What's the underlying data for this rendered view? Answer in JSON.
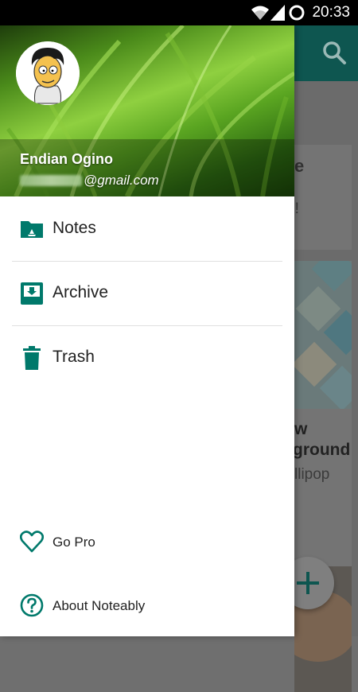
{
  "status_bar": {
    "time": "20:33",
    "icons": [
      "wifi-icon",
      "signal-icon",
      "sync-icon"
    ]
  },
  "drawer": {
    "user": {
      "name": "Endian Ogino",
      "email_visible": "@gmail.com"
    },
    "menu": [
      {
        "label": "Notes",
        "icon": "drive-folder-icon"
      },
      {
        "label": "Archive",
        "icon": "archive-icon"
      },
      {
        "label": "Trash",
        "icon": "trash-icon"
      }
    ],
    "footer": [
      {
        "label": "Go Pro",
        "icon": "heart-icon"
      },
      {
        "label": "About Noteably",
        "icon": "help-icon"
      }
    ]
  },
  "background_app": {
    "toolbar_icon": "search-icon",
    "cards": [
      {
        "title_fragment": "e",
        "body_fragment": "n!"
      },
      {
        "title_line1": "w",
        "title_line2": "ground",
        "body_fragment": "llipop"
      }
    ],
    "fab_icon": "add-icon"
  },
  "colors": {
    "accent": "#00796b",
    "toolbar": "#00796b",
    "status_bar": "#000000",
    "drawer_bg": "#ffffff"
  }
}
